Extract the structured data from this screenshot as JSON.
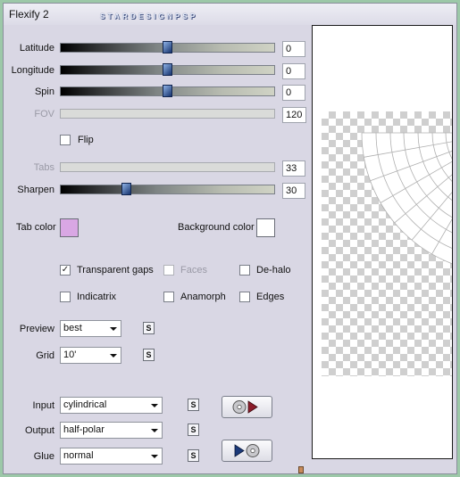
{
  "window": {
    "title": "Flexify 2",
    "watermark": "STARDESIGNPSP"
  },
  "sliders": [
    {
      "label": "Latitude",
      "value": "0",
      "level": 0.5,
      "enabled": true
    },
    {
      "label": "Longitude",
      "value": "0",
      "level": 0.5,
      "enabled": true
    },
    {
      "label": "Spin",
      "value": "0",
      "level": 0.5,
      "enabled": true
    },
    {
      "label": "FOV",
      "value": "120",
      "enabled": false
    },
    {
      "label": "Tabs",
      "value": "33",
      "enabled": false
    },
    {
      "label": "Sharpen",
      "value": "30",
      "level": 0.3,
      "enabled": true
    }
  ],
  "flip": {
    "label": "Flip",
    "checked": false
  },
  "tab_color": {
    "label": "Tab color",
    "color": "#d9a7e4"
  },
  "background_color": {
    "label": "Background color",
    "color": "#ffffff"
  },
  "options": {
    "transparent_gaps": {
      "label": "Transparent gaps",
      "checked": true
    },
    "faces": {
      "label": "Faces",
      "checked": false,
      "enabled": false
    },
    "de_halo": {
      "label": "De-halo",
      "checked": false
    },
    "indicatrix": {
      "label": "Indicatrix",
      "checked": false
    },
    "anamorph": {
      "label": "Anamorph",
      "checked": false
    },
    "edges": {
      "label": "Edges",
      "checked": false
    }
  },
  "preview_select": {
    "label": "Preview",
    "value": "best"
  },
  "grid_select": {
    "label": "Grid",
    "value": "10'"
  },
  "input_select": {
    "label": "Input",
    "value": "cylindrical"
  },
  "output_select": {
    "label": "Output",
    "value": "half-polar"
  },
  "glue_select": {
    "label": "Glue",
    "value": "normal"
  },
  "s_button": "S",
  "icons": {
    "play_forward": "disc-play-icon",
    "play_backward": "play-disc-icon"
  }
}
